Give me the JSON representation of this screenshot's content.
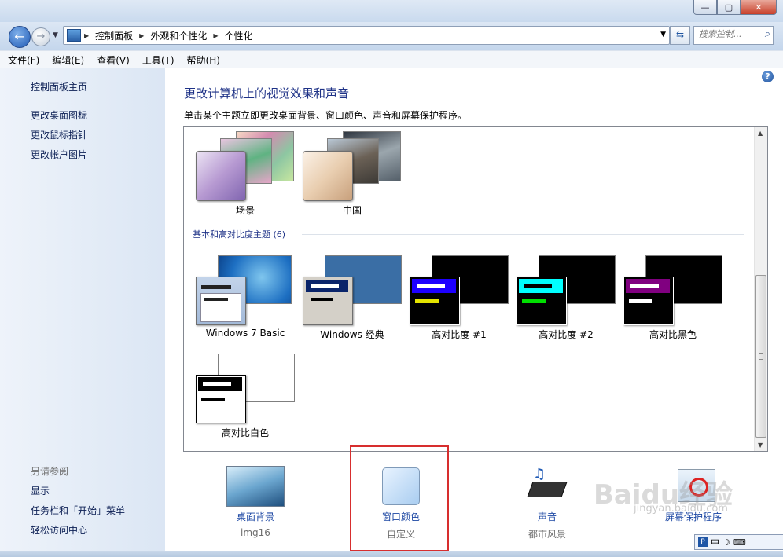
{
  "window": {
    "minimize_glyph": "—",
    "maximize_glyph": "▢",
    "close_glyph": "✕"
  },
  "nav": {
    "back_glyph": "←",
    "forward_glyph": "→",
    "breadcrumbs": [
      "控制面板",
      "外观和个性化",
      "个性化"
    ],
    "refresh_glyph": "⇆",
    "search_placeholder": "搜索控制..."
  },
  "menu": [
    "文件(F)",
    "编辑(E)",
    "查看(V)",
    "工具(T)",
    "帮助(H)"
  ],
  "sidebar": {
    "home_link": "控制面板主页",
    "links": [
      "更改桌面图标",
      "更改鼠标指针",
      "更改帐户图片"
    ],
    "see_also_heading": "另请参阅",
    "see_also": [
      "显示",
      "任务栏和「开始」菜单",
      "轻松访问中心"
    ]
  },
  "main": {
    "help_glyph": "?",
    "title": "更改计算机上的视觉效果和声音",
    "description": "单击某个主题立即更改桌面背景、窗口颜色、声音和屏幕保护程序。",
    "installed_themes": [
      "场景",
      "中国"
    ],
    "basic_section_heading": "基本和高对比度主题 (6)",
    "basic_themes": [
      "Windows 7 Basic",
      "Windows 经典",
      "高对比度 #1",
      "高对比度 #2",
      "高对比黑色",
      "高对比白色"
    ]
  },
  "bottom": {
    "desktop_background": {
      "label": "桌面背景",
      "value": "img16"
    },
    "window_color": {
      "label": "窗口颜色",
      "value": "自定义"
    },
    "sounds": {
      "label": "声音",
      "value": "都市风景"
    },
    "screensaver": {
      "label": "屏幕保护程序"
    }
  },
  "watermark": {
    "text": "Baidu经验",
    "sub": "jingyan.baidu.com"
  },
  "ime": {
    "logo": "P",
    "lang": "中",
    "moon": "☽",
    "keyboard": "⌨"
  },
  "colors": {
    "title_blue": "#1e3287",
    "link_blue": "#1c47a3",
    "highlight_red": "#d72e2e",
    "win_blue": "#0078d7"
  }
}
